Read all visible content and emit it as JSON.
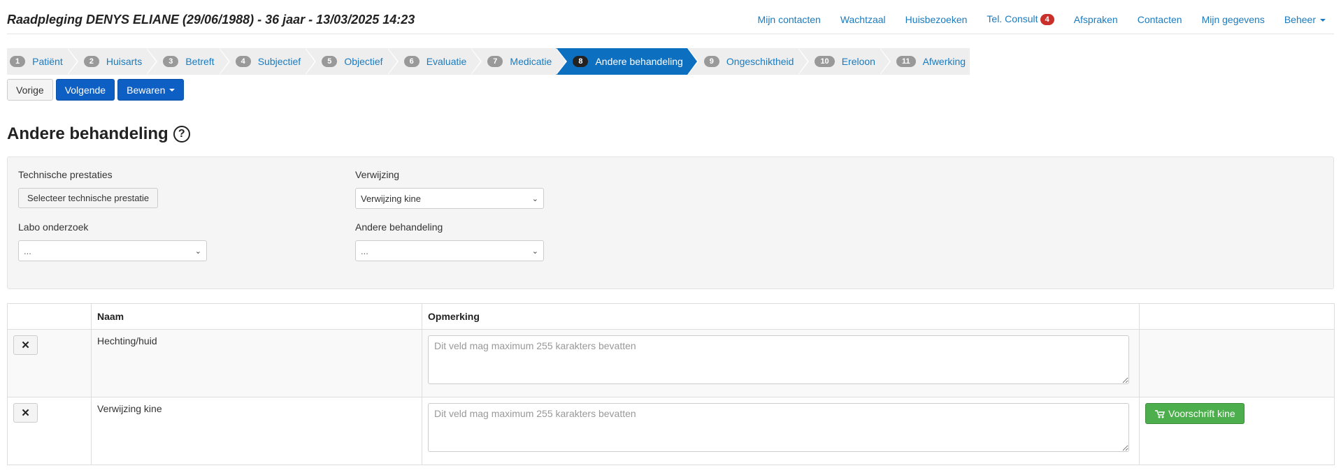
{
  "header": {
    "title": "Raadpleging DENYS ELIANE (29/06/1988) - 36 jaar - 13/03/2025 14:23",
    "nav": {
      "mijn_contacten": "Mijn contacten",
      "wachtzaal": "Wachtzaal",
      "huisbezoeken": "Huisbezoeken",
      "tel_consult": "Tel. Consult",
      "tel_consult_badge": "4",
      "afspraken": "Afspraken",
      "contacten": "Contacten",
      "mijn_gegevens": "Mijn gegevens",
      "beheer": "Beheer"
    }
  },
  "steps": [
    {
      "num": "1",
      "label": "Patiënt"
    },
    {
      "num": "2",
      "label": "Huisarts"
    },
    {
      "num": "3",
      "label": "Betreft"
    },
    {
      "num": "4",
      "label": "Subjectief"
    },
    {
      "num": "5",
      "label": "Objectief"
    },
    {
      "num": "6",
      "label": "Evaluatie"
    },
    {
      "num": "7",
      "label": "Medicatie"
    },
    {
      "num": "8",
      "label": "Andere behandeling"
    },
    {
      "num": "9",
      "label": "Ongeschiktheid"
    },
    {
      "num": "10",
      "label": "Ereloon"
    },
    {
      "num": "11",
      "label": "Afwerking"
    }
  ],
  "active_step": "8",
  "actions": {
    "vorige": "Vorige",
    "volgende": "Volgende",
    "bewaren": "Bewaren"
  },
  "section": {
    "title": "Andere behandeling",
    "help": "?"
  },
  "form": {
    "technische_label": "Technische prestaties",
    "technische_button": "Selecteer technische prestatie",
    "verwijzing_label": "Verwijzing",
    "verwijzing_value": "Verwijzing kine",
    "labo_label": "Labo onderzoek",
    "labo_value": "...",
    "andere_label": "Andere behandeling",
    "andere_value": "..."
  },
  "table": {
    "columns": [
      "",
      "Naam",
      "Opmerking",
      ""
    ],
    "remove_label": "✕",
    "rows": [
      {
        "naam": "Hechting/huid",
        "placeholder": "Dit veld mag maximum 255 karakters bevatten"
      },
      {
        "naam": "Verwijzing kine",
        "placeholder": "Dit veld mag maximum 255 karakters bevatten",
        "action": "Voorschrift kine"
      }
    ]
  },
  "colors": {
    "link": "#1a7bbf",
    "active_step": "#0d6fc0",
    "primary": "#0d5fc4",
    "success": "#4cae4c",
    "badge": "#c9302c"
  }
}
